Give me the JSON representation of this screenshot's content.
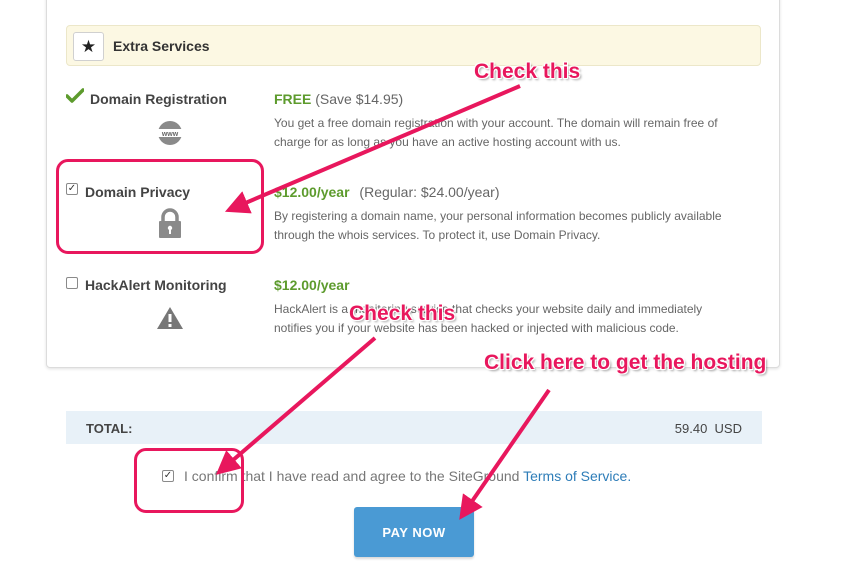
{
  "extra_services": {
    "title": "Extra Services",
    "icon": "star-icon"
  },
  "services": [
    {
      "name": "Domain Registration",
      "price": "FREE",
      "price_note": "(Save $14.95)",
      "description_line1": "You get a free domain registration with your account. The domain will remain free of",
      "description_line2": "charge for as long as you have an active hosting account with us.",
      "checked": true,
      "icon": "www-icon"
    },
    {
      "name": "Domain Privacy",
      "price": "$12.00/year",
      "price_note": "(Regular: $24.00/year)",
      "description_line1": "By registering a domain name, your personal information becomes publicly available",
      "description_line2": "through the whois services. To protect it, use Domain Privacy.",
      "checked": true,
      "icon": "lock-icon"
    },
    {
      "name": "HackAlert Monitoring",
      "price": "$12.00/year",
      "price_note": "",
      "description_line1": "HackAlert is a monitoring service that checks your website daily and immediately",
      "description_line2": "notifies you if your website has been hacked or injected with malicious code.",
      "checked": false,
      "icon": "warning-icon"
    }
  ],
  "total": {
    "label": "TOTAL:",
    "amount": "59.40",
    "currency": "USD"
  },
  "confirm": {
    "text": "I confirm that I have read and agree to the SiteGround",
    "link": "Terms of Service.",
    "checked": true
  },
  "pay_button": {
    "label": "PAY NOW"
  },
  "annotations": {
    "check_this_1": "Check this",
    "check_this_2": "Check this",
    "click_here": "Click here to get the hosting"
  },
  "colors": {
    "accent": "#e8175d",
    "price_green": "#5d9b2d",
    "button_blue": "#4a9ad4",
    "link_blue": "#2e7db8",
    "header_bg": "#fcf8e3",
    "total_bg": "#e8f1f8"
  }
}
